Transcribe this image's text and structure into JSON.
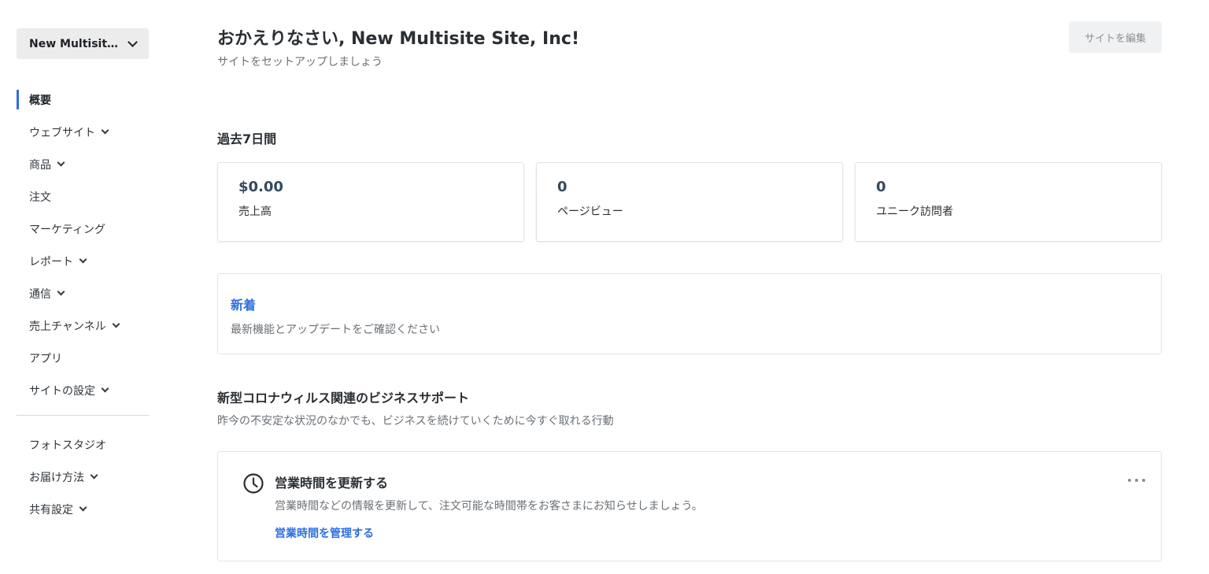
{
  "sidebar": {
    "site_name": "New Multisite Site, Inc!",
    "items": [
      {
        "label": "概要"
      },
      {
        "label": "ウェブサイト"
      },
      {
        "label": "商品"
      },
      {
        "label": "注文"
      },
      {
        "label": "マーケティング"
      },
      {
        "label": "レポート"
      },
      {
        "label": "通信"
      },
      {
        "label": "売上チャンネル"
      },
      {
        "label": "アプリ"
      },
      {
        "label": "サイトの設定"
      }
    ],
    "items2": [
      {
        "label": "フォトスタジオ"
      },
      {
        "label": "お届け方法"
      },
      {
        "label": "共有設定"
      }
    ]
  },
  "header": {
    "title": "おかえりなさい, New Multisite Site, Inc!",
    "subtitle": "サイトをセットアップしましょう",
    "edit_button": "サイトを編集"
  },
  "stats": {
    "heading": "過去7日間",
    "cards": [
      {
        "value": "$0.00",
        "label": "売上高"
      },
      {
        "value": "0",
        "label": "ページビュー"
      },
      {
        "value": "0",
        "label": "ユニーク訪問者"
      }
    ]
  },
  "news": {
    "title": "新着",
    "subtitle": "最新機能とアップデートをご確認ください"
  },
  "covid": {
    "title": "新型コロナウィルス関連のビジネスサポート",
    "subtitle": "昨今の不安定な状況のなかでも、ビジネスを続けていくために今すぐ取れる行動",
    "task": {
      "title": "営業時間を更新する",
      "description": "営業時間などの情報を更新して、注文可能な時間帯をお客さまにお知らせしましょう。",
      "link": "営業時間を管理する"
    }
  },
  "colors": {
    "accent": "#2f6fe0",
    "switcher_bg": "#ececec",
    "text_primary": "#2a2f34",
    "text_secondary": "#6a7076"
  }
}
